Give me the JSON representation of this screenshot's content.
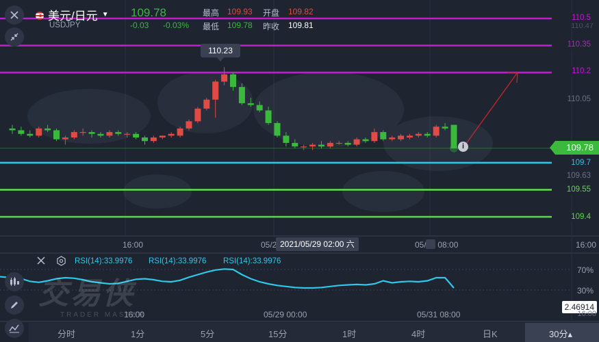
{
  "header": {
    "title": "美元/日元",
    "symbol": "USDJPY",
    "price": "109.78",
    "change": "-0.03",
    "change_pct": "-0.03%",
    "high_label": "最高",
    "high_value": "109.93",
    "open_label": "开盘",
    "open_value": "109.82",
    "low_label": "最低",
    "low_value": "109.78",
    "prev_close_label": "昨收",
    "prev_close_value": "109.81"
  },
  "price_axis": {
    "levels": [
      {
        "label": "110.5",
        "color": "#c01cd0"
      },
      {
        "label": "110.35",
        "color": "#c01cd0"
      },
      {
        "label": "110.2",
        "color": "#c01cd0"
      },
      {
        "label": "110.05",
        "color": "#6b7282"
      },
      {
        "label": "109.78",
        "color": "#3ab93d"
      },
      {
        "label": "109.7",
        "color": "#29c6e6"
      },
      {
        "label": "109.63",
        "color": "#6b7282"
      },
      {
        "label": "109.55",
        "color": "#5fd94a"
      },
      {
        "label": "109.4",
        "color": "#5fd94a"
      }
    ],
    "top_partial": "110.47",
    "peak_label": "110.23"
  },
  "time_axis": {
    "labels": [
      "16:00",
      "05/2",
      "05/31 08:00",
      "16:00"
    ],
    "crosshair": "2021/05/29 02:00 六"
  },
  "rsi": {
    "labels": [
      "RSI(14):33.9976",
      "RSI(14):33.9976",
      "RSI(14):33.9976"
    ],
    "level_70": "70%",
    "level_30": "30%",
    "value_box": "2.46914",
    "axis_bottom": "16:00",
    "time_labels": [
      "16:00",
      "05/29 00:00",
      "05/31 08:00"
    ],
    "watermark": "交易侠",
    "watermark_sub": "TRADER MASTER"
  },
  "tabs": [
    {
      "label": "分时"
    },
    {
      "label": "1分"
    },
    {
      "label": "5分"
    },
    {
      "label": "15分"
    },
    {
      "label": "1时"
    },
    {
      "label": "4时"
    },
    {
      "label": "日K"
    },
    {
      "label": "30分▴"
    }
  ],
  "icons": {
    "close": "close-icon",
    "collapse": "collapse-icon",
    "rsi_close": "close-icon",
    "rsi_settings": "gear-icon",
    "candles": "candlestick-icon",
    "draw": "pencil-icon",
    "indicator": "indicator-icon"
  },
  "colors": {
    "up": "#e04b45",
    "down": "#3ab93d",
    "background": "#1f2431",
    "resistance": "#c01cd0",
    "support_blue": "#29c6e6",
    "support_green": "#5fd94a",
    "rsi_line": "#2ec8e8",
    "arrow": "#c8242c"
  },
  "chart_data": {
    "type": "candlestick",
    "price_range": [
      109.4,
      110.5
    ],
    "candles": [
      {
        "o": 109.89,
        "h": 109.91,
        "l": 109.86,
        "c": 109.88
      },
      {
        "o": 109.88,
        "h": 109.9,
        "l": 109.85,
        "c": 109.86
      },
      {
        "o": 109.86,
        "h": 109.88,
        "l": 109.84,
        "c": 109.85
      },
      {
        "o": 109.85,
        "h": 109.9,
        "l": 109.84,
        "c": 109.89
      },
      {
        "o": 109.89,
        "h": 109.91,
        "l": 109.87,
        "c": 109.88
      },
      {
        "o": 109.88,
        "h": 109.89,
        "l": 109.82,
        "c": 109.83
      },
      {
        "o": 109.83,
        "h": 109.85,
        "l": 109.8,
        "c": 109.84
      },
      {
        "o": 109.84,
        "h": 109.88,
        "l": 109.83,
        "c": 109.87
      },
      {
        "o": 109.87,
        "h": 109.89,
        "l": 109.85,
        "c": 109.87
      },
      {
        "o": 109.87,
        "h": 109.88,
        "l": 109.84,
        "c": 109.86
      },
      {
        "o": 109.86,
        "h": 109.87,
        "l": 109.84,
        "c": 109.85
      },
      {
        "o": 109.85,
        "h": 109.88,
        "l": 109.84,
        "c": 109.87
      },
      {
        "o": 109.87,
        "h": 109.88,
        "l": 109.85,
        "c": 109.86
      },
      {
        "o": 109.86,
        "h": 109.87,
        "l": 109.84,
        "c": 109.86
      },
      {
        "o": 109.86,
        "h": 109.87,
        "l": 109.83,
        "c": 109.84
      },
      {
        "o": 109.84,
        "h": 109.85,
        "l": 109.8,
        "c": 109.82
      },
      {
        "o": 109.82,
        "h": 109.85,
        "l": 109.81,
        "c": 109.84
      },
      {
        "o": 109.84,
        "h": 109.85,
        "l": 109.83,
        "c": 109.85
      },
      {
        "o": 109.85,
        "h": 109.87,
        "l": 109.84,
        "c": 109.86
      },
      {
        "o": 109.85,
        "h": 109.9,
        "l": 109.84,
        "c": 109.89
      },
      {
        "o": 109.89,
        "h": 109.94,
        "l": 109.88,
        "c": 109.93
      },
      {
        "o": 109.93,
        "h": 110.01,
        "l": 109.92,
        "c": 110.0
      },
      {
        "o": 110.0,
        "h": 110.06,
        "l": 109.99,
        "c": 110.05
      },
      {
        "o": 110.05,
        "h": 110.16,
        "l": 109.95,
        "c": 110.15
      },
      {
        "o": 110.15,
        "h": 110.23,
        "l": 110.13,
        "c": 110.19
      },
      {
        "o": 110.19,
        "h": 110.2,
        "l": 110.1,
        "c": 110.12
      },
      {
        "o": 110.12,
        "h": 110.14,
        "l": 110.02,
        "c": 110.03
      },
      {
        "o": 110.03,
        "h": 110.06,
        "l": 110.01,
        "c": 110.02
      },
      {
        "o": 110.02,
        "h": 110.04,
        "l": 109.98,
        "c": 109.99
      },
      {
        "o": 109.99,
        "h": 110.01,
        "l": 109.91,
        "c": 109.92
      },
      {
        "o": 109.92,
        "h": 109.93,
        "l": 109.84,
        "c": 109.85
      },
      {
        "o": 109.85,
        "h": 109.87,
        "l": 109.79,
        "c": 109.81
      },
      {
        "o": 109.81,
        "h": 109.83,
        "l": 109.78,
        "c": 109.79
      },
      {
        "o": 109.79,
        "h": 109.8,
        "l": 109.77,
        "c": 109.79
      },
      {
        "o": 109.79,
        "h": 109.81,
        "l": 109.77,
        "c": 109.8
      },
      {
        "o": 109.8,
        "h": 109.82,
        "l": 109.78,
        "c": 109.79
      },
      {
        "o": 109.79,
        "h": 109.82,
        "l": 109.78,
        "c": 109.81
      },
      {
        "o": 109.81,
        "h": 109.82,
        "l": 109.8,
        "c": 109.81
      },
      {
        "o": 109.81,
        "h": 109.82,
        "l": 109.79,
        "c": 109.8
      },
      {
        "o": 109.8,
        "h": 109.84,
        "l": 109.79,
        "c": 109.83
      },
      {
        "o": 109.83,
        "h": 109.84,
        "l": 109.81,
        "c": 109.82
      },
      {
        "o": 109.82,
        "h": 109.89,
        "l": 109.81,
        "c": 109.87
      },
      {
        "o": 109.87,
        "h": 109.88,
        "l": 109.82,
        "c": 109.83
      },
      {
        "o": 109.83,
        "h": 109.85,
        "l": 109.82,
        "c": 109.84
      },
      {
        "o": 109.83,
        "h": 109.86,
        "l": 109.82,
        "c": 109.85
      },
      {
        "o": 109.84,
        "h": 109.86,
        "l": 109.83,
        "c": 109.85
      },
      {
        "o": 109.85,
        "h": 109.87,
        "l": 109.84,
        "c": 109.86
      },
      {
        "o": 109.86,
        "h": 109.87,
        "l": 109.84,
        "c": 109.85
      },
      {
        "o": 109.85,
        "h": 109.91,
        "l": 109.84,
        "c": 109.9
      },
      {
        "o": 109.9,
        "h": 109.92,
        "l": 109.88,
        "c": 109.89
      },
      {
        "o": 109.91,
        "h": 109.91,
        "l": 109.78,
        "c": 109.78
      }
    ],
    "rsi_values": [
      56,
      52,
      47,
      45,
      48,
      52,
      54,
      53,
      50,
      46,
      44,
      42,
      43,
      47,
      51,
      52,
      50,
      47,
      46,
      49,
      55,
      60,
      65,
      69,
      71,
      70,
      60,
      52,
      46,
      42,
      39,
      37,
      35,
      34,
      34,
      35,
      37,
      39,
      40,
      41,
      40,
      42,
      48,
      44,
      46,
      47,
      46,
      48,
      54,
      54,
      34
    ],
    "horizontal_levels": [
      110.5,
      110.35,
      110.2,
      109.7,
      109.55,
      109.4
    ],
    "last_price": 109.78,
    "peak": 110.23,
    "rsi_levels": [
      70,
      30
    ]
  }
}
